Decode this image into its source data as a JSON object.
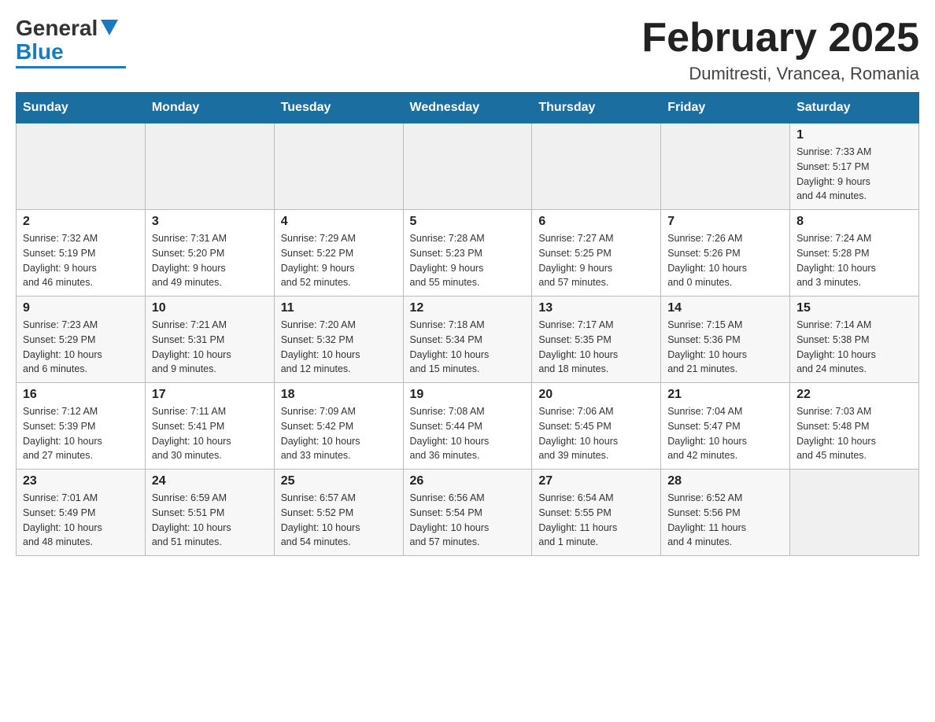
{
  "header": {
    "logo_general": "General",
    "logo_blue": "Blue",
    "month_title": "February 2025",
    "location": "Dumitresti, Vrancea, Romania"
  },
  "days_of_week": [
    "Sunday",
    "Monday",
    "Tuesday",
    "Wednesday",
    "Thursday",
    "Friday",
    "Saturday"
  ],
  "weeks": [
    {
      "days": [
        {
          "num": "",
          "info": ""
        },
        {
          "num": "",
          "info": ""
        },
        {
          "num": "",
          "info": ""
        },
        {
          "num": "",
          "info": ""
        },
        {
          "num": "",
          "info": ""
        },
        {
          "num": "",
          "info": ""
        },
        {
          "num": "1",
          "info": "Sunrise: 7:33 AM\nSunset: 5:17 PM\nDaylight: 9 hours\nand 44 minutes."
        }
      ]
    },
    {
      "days": [
        {
          "num": "2",
          "info": "Sunrise: 7:32 AM\nSunset: 5:19 PM\nDaylight: 9 hours\nand 46 minutes."
        },
        {
          "num": "3",
          "info": "Sunrise: 7:31 AM\nSunset: 5:20 PM\nDaylight: 9 hours\nand 49 minutes."
        },
        {
          "num": "4",
          "info": "Sunrise: 7:29 AM\nSunset: 5:22 PM\nDaylight: 9 hours\nand 52 minutes."
        },
        {
          "num": "5",
          "info": "Sunrise: 7:28 AM\nSunset: 5:23 PM\nDaylight: 9 hours\nand 55 minutes."
        },
        {
          "num": "6",
          "info": "Sunrise: 7:27 AM\nSunset: 5:25 PM\nDaylight: 9 hours\nand 57 minutes."
        },
        {
          "num": "7",
          "info": "Sunrise: 7:26 AM\nSunset: 5:26 PM\nDaylight: 10 hours\nand 0 minutes."
        },
        {
          "num": "8",
          "info": "Sunrise: 7:24 AM\nSunset: 5:28 PM\nDaylight: 10 hours\nand 3 minutes."
        }
      ]
    },
    {
      "days": [
        {
          "num": "9",
          "info": "Sunrise: 7:23 AM\nSunset: 5:29 PM\nDaylight: 10 hours\nand 6 minutes."
        },
        {
          "num": "10",
          "info": "Sunrise: 7:21 AM\nSunset: 5:31 PM\nDaylight: 10 hours\nand 9 minutes."
        },
        {
          "num": "11",
          "info": "Sunrise: 7:20 AM\nSunset: 5:32 PM\nDaylight: 10 hours\nand 12 minutes."
        },
        {
          "num": "12",
          "info": "Sunrise: 7:18 AM\nSunset: 5:34 PM\nDaylight: 10 hours\nand 15 minutes."
        },
        {
          "num": "13",
          "info": "Sunrise: 7:17 AM\nSunset: 5:35 PM\nDaylight: 10 hours\nand 18 minutes."
        },
        {
          "num": "14",
          "info": "Sunrise: 7:15 AM\nSunset: 5:36 PM\nDaylight: 10 hours\nand 21 minutes."
        },
        {
          "num": "15",
          "info": "Sunrise: 7:14 AM\nSunset: 5:38 PM\nDaylight: 10 hours\nand 24 minutes."
        }
      ]
    },
    {
      "days": [
        {
          "num": "16",
          "info": "Sunrise: 7:12 AM\nSunset: 5:39 PM\nDaylight: 10 hours\nand 27 minutes."
        },
        {
          "num": "17",
          "info": "Sunrise: 7:11 AM\nSunset: 5:41 PM\nDaylight: 10 hours\nand 30 minutes."
        },
        {
          "num": "18",
          "info": "Sunrise: 7:09 AM\nSunset: 5:42 PM\nDaylight: 10 hours\nand 33 minutes."
        },
        {
          "num": "19",
          "info": "Sunrise: 7:08 AM\nSunset: 5:44 PM\nDaylight: 10 hours\nand 36 minutes."
        },
        {
          "num": "20",
          "info": "Sunrise: 7:06 AM\nSunset: 5:45 PM\nDaylight: 10 hours\nand 39 minutes."
        },
        {
          "num": "21",
          "info": "Sunrise: 7:04 AM\nSunset: 5:47 PM\nDaylight: 10 hours\nand 42 minutes."
        },
        {
          "num": "22",
          "info": "Sunrise: 7:03 AM\nSunset: 5:48 PM\nDaylight: 10 hours\nand 45 minutes."
        }
      ]
    },
    {
      "days": [
        {
          "num": "23",
          "info": "Sunrise: 7:01 AM\nSunset: 5:49 PM\nDaylight: 10 hours\nand 48 minutes."
        },
        {
          "num": "24",
          "info": "Sunrise: 6:59 AM\nSunset: 5:51 PM\nDaylight: 10 hours\nand 51 minutes."
        },
        {
          "num": "25",
          "info": "Sunrise: 6:57 AM\nSunset: 5:52 PM\nDaylight: 10 hours\nand 54 minutes."
        },
        {
          "num": "26",
          "info": "Sunrise: 6:56 AM\nSunset: 5:54 PM\nDaylight: 10 hours\nand 57 minutes."
        },
        {
          "num": "27",
          "info": "Sunrise: 6:54 AM\nSunset: 5:55 PM\nDaylight: 11 hours\nand 1 minute."
        },
        {
          "num": "28",
          "info": "Sunrise: 6:52 AM\nSunset: 5:56 PM\nDaylight: 11 hours\nand 4 minutes."
        },
        {
          "num": "",
          "info": ""
        }
      ]
    }
  ]
}
